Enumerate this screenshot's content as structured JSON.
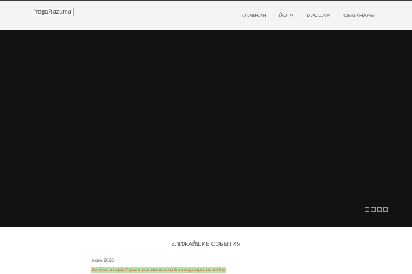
{
  "header": {
    "logo_text": "YogaRazuma",
    "nav": [
      "ГЛАВНАЯ",
      "ЙОГА",
      "МАССАЖ",
      "СЕМИНАРЫ"
    ]
  },
  "hero": {
    "slide_count": 4,
    "background_color": "#121212"
  },
  "events": {
    "title": "БЛИЖАЙШИЕ СОБЫТИЯ",
    "month": "июнь 2023",
    "items": [
      {
        "label": "ВелЙога в парке Горького/летние классы йоги под открытым небом"
      }
    ]
  },
  "colors": {
    "header_bg": "#f4f4f4",
    "event_highlight": "#b8e0a8",
    "event_text": "#d26a4a"
  }
}
